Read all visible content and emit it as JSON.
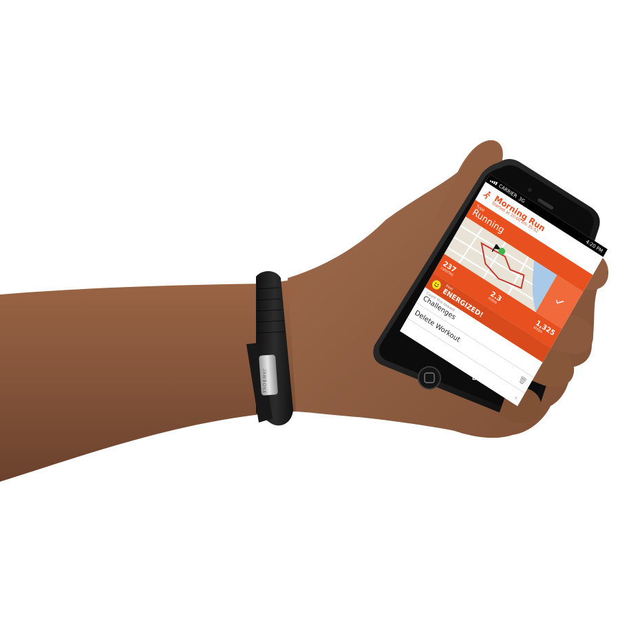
{
  "status_bar": {
    "carrier": "CARRIER",
    "network": "3G",
    "time": "4:20 PM"
  },
  "workout": {
    "title": "Morning Run",
    "subtitle": "Started at 10:00 am 35:52",
    "type_label": "Type",
    "type_value": "Running",
    "feeling_label": "Feel",
    "feeling_value": "ENERGIZED!",
    "stats": [
      {
        "value": "237",
        "unit": "calories"
      },
      {
        "value": "2.3",
        "unit": "miles"
      },
      {
        "value": "1,325",
        "unit": "steps"
      }
    ],
    "map_markers": [
      "start-flag-icon",
      "finish-flag-icon"
    ]
  },
  "list": {
    "challenges_label": "Count this toward",
    "challenges_value": "Challenges",
    "delete_label": "Delete Workout"
  },
  "done_label": "DONE",
  "band_brand": "JAWBONE",
  "colors": {
    "accent": "#e8501f",
    "band": "#1c1c1c",
    "phone": "#0b0b0b",
    "skin": "#8a5a3c"
  }
}
